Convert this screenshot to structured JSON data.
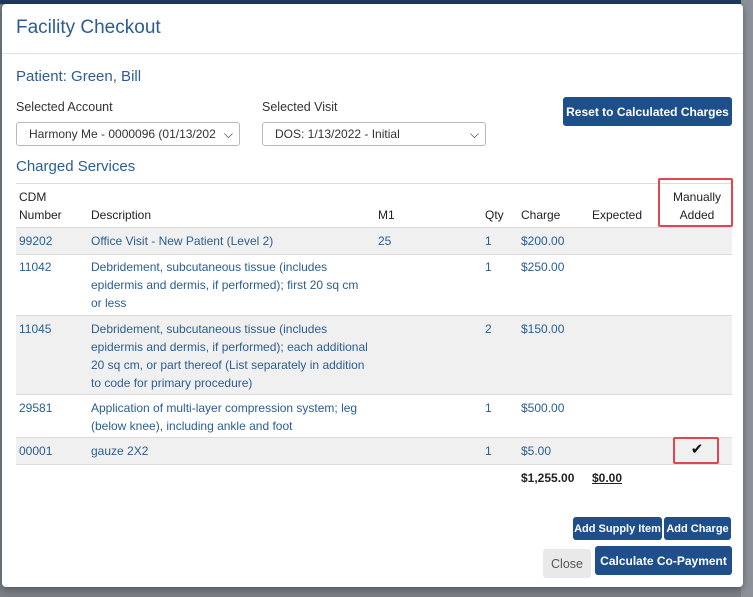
{
  "dialog": {
    "title": "Facility Checkout"
  },
  "patient": {
    "label": "Patient: Green, Bill"
  },
  "account": {
    "label": "Selected Account",
    "value": "Harmony Me - 0000096 (01/13/202"
  },
  "visit": {
    "label": "Selected Visit",
    "value": "DOS: 1/13/2022 - Initial"
  },
  "reset_button": "Reset to Calculated Charges",
  "services": {
    "title": "Charged Services",
    "headers": {
      "cdm_line1": "CDM",
      "cdm_line2": "Number",
      "description": "Description",
      "m1": "M1",
      "qty": "Qty",
      "charge": "Charge",
      "expected": "Expected",
      "manual_line1": "Manually",
      "manual_line2": "Added"
    },
    "rows": [
      {
        "cdm": "99202",
        "description": "Office Visit - New Patient (Level 2)",
        "m1": "25",
        "qty": "1",
        "charge": "$200.00",
        "expected": "",
        "manual": false
      },
      {
        "cdm": "11042",
        "description": "Debridement, subcutaneous tissue (includes epidermis and dermis, if performed); first 20 sq cm or less",
        "m1": "",
        "qty": "1",
        "charge": "$250.00",
        "expected": "",
        "manual": false
      },
      {
        "cdm": "11045",
        "description": "Debridement, subcutaneous tissue (includes epidermis and dermis, if performed); each additional 20 sq cm, or part thereof (List separately in addition to code for primary procedure)",
        "m1": "",
        "qty": "2",
        "charge": "$150.00",
        "expected": "",
        "manual": false
      },
      {
        "cdm": "29581",
        "description": "Application of multi-layer compression system; leg (below knee), including ankle and foot",
        "m1": "",
        "qty": "1",
        "charge": "$500.00",
        "expected": "",
        "manual": false
      },
      {
        "cdm": "00001",
        "description": "gauze 2X2",
        "m1": "",
        "qty": "1",
        "charge": "$5.00",
        "expected": "",
        "manual": true
      }
    ],
    "total_charge": "$1,255.00",
    "total_expected": "$0.00",
    "check_glyph": "✔"
  },
  "buttons": {
    "add_supply": "Add Supply Item",
    "add_charge": "Add Charge",
    "close": "Close",
    "calculate": "Calculate Co-Payment"
  },
  "colors": {
    "primary": "#1f4f8a",
    "link": "#2a5d93",
    "highlight": "#e0464f"
  }
}
